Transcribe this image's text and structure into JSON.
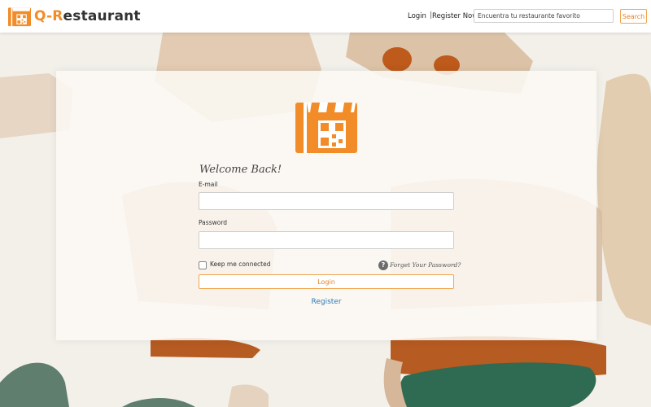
{
  "brand": {
    "name_prefix": "Q-R",
    "name_suffix": "estaurant",
    "accent_color": "#f28c28",
    "icon": "qr-store-icon"
  },
  "header": {
    "login_label": "Login",
    "separator": "|",
    "register_label": "Register Now!",
    "search_placeholder": "Encuentra tu restaurante favorito",
    "search_button_label": "Search"
  },
  "login_card": {
    "icon": "qr-store-icon",
    "welcome": "Welcome Back!",
    "email_label": "E-mail",
    "email_value": "",
    "password_label": "Password",
    "password_value": "",
    "keep_connected_label": "Keep me connected",
    "keep_connected_checked": false,
    "help_icon": "question-circle-icon",
    "forgot_label": "Forget Your Password?",
    "login_button_label": "Login",
    "register_link": "Register"
  },
  "colors": {
    "button_border": "#f2a54e",
    "button_text": "#e8812a",
    "link": "#2a7ab8"
  }
}
